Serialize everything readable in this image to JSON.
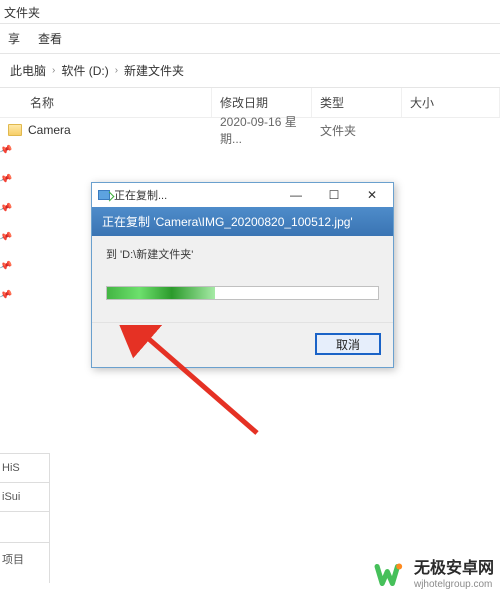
{
  "window": {
    "title_suffix": "文件夹"
  },
  "menu": {
    "share": "享",
    "view": "查看"
  },
  "breadcrumb": {
    "seg1": "此电脑",
    "seg2": "软件 (D:)",
    "seg3": "新建文件夹"
  },
  "table": {
    "headers": {
      "name": "名称",
      "date": "修改日期",
      "type": "类型",
      "size": "大小"
    },
    "rows": [
      {
        "name": "Camera",
        "date": "2020-09-16 星期...",
        "type": "文件夹",
        "size": ""
      }
    ]
  },
  "dialog": {
    "title": "正在复制...",
    "banner": "正在复制 'Camera\\IMG_20200820_100512.jpg'",
    "destination_line": "到 'D:\\新建文件夹'",
    "progress_percent": 40,
    "cancel_label": "取消",
    "min_glyph": "—",
    "max_glyph": "☐",
    "close_glyph": "✕"
  },
  "sidebar_bottom": {
    "item1": "HiS",
    "item2": "iSui",
    "item3": "项目"
  },
  "watermark": {
    "main": "无极安卓网",
    "sub": "wjhotelgroup.com"
  }
}
